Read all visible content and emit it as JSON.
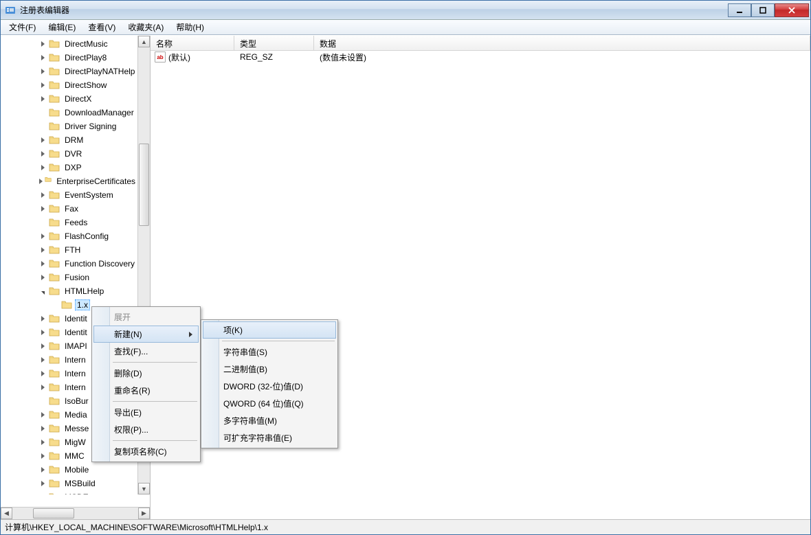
{
  "titlebar": {
    "title": "注册表编辑器"
  },
  "menu": {
    "file": "文件(F)",
    "edit": "编辑(E)",
    "view": "查看(V)",
    "favorites": "收藏夹(A)",
    "help": "帮助(H)"
  },
  "tree": {
    "items": [
      {
        "label": "DirectMusic",
        "expandable": true,
        "indent": 3
      },
      {
        "label": "DirectPlay8",
        "expandable": true,
        "indent": 3
      },
      {
        "label": "DirectPlayNATHelp",
        "expandable": true,
        "indent": 3
      },
      {
        "label": "DirectShow",
        "expandable": true,
        "indent": 3
      },
      {
        "label": "DirectX",
        "expandable": true,
        "indent": 3
      },
      {
        "label": "DownloadManager",
        "expandable": false,
        "indent": 3
      },
      {
        "label": "Driver Signing",
        "expandable": false,
        "indent": 3
      },
      {
        "label": "DRM",
        "expandable": true,
        "indent": 3
      },
      {
        "label": "DVR",
        "expandable": true,
        "indent": 3
      },
      {
        "label": "DXP",
        "expandable": true,
        "indent": 3
      },
      {
        "label": "EnterpriseCertificates",
        "expandable": true,
        "indent": 3
      },
      {
        "label": "EventSystem",
        "expandable": true,
        "indent": 3
      },
      {
        "label": "Fax",
        "expandable": true,
        "indent": 3
      },
      {
        "label": "Feeds",
        "expandable": false,
        "indent": 3
      },
      {
        "label": "FlashConfig",
        "expandable": true,
        "indent": 3
      },
      {
        "label": "FTH",
        "expandable": true,
        "indent": 3
      },
      {
        "label": "Function Discovery",
        "expandable": true,
        "indent": 3
      },
      {
        "label": "Fusion",
        "expandable": true,
        "indent": 3
      }
    ],
    "html_help_label": "HTMLHelp",
    "selected": "1.x",
    "items_after": [
      {
        "label": "Identit",
        "expandable": true,
        "indent": 3
      },
      {
        "label": "Identit",
        "expandable": true,
        "indent": 3
      },
      {
        "label": "IMAPI",
        "expandable": true,
        "indent": 3
      },
      {
        "label": "Intern",
        "expandable": true,
        "indent": 3
      },
      {
        "label": "Intern",
        "expandable": true,
        "indent": 3
      },
      {
        "label": "Intern",
        "expandable": true,
        "indent": 3
      },
      {
        "label": "IsoBur",
        "expandable": false,
        "indent": 3
      },
      {
        "label": "Media",
        "expandable": true,
        "indent": 3
      },
      {
        "label": "Messe",
        "expandable": true,
        "indent": 3
      },
      {
        "label": "MigW",
        "expandable": true,
        "indent": 3
      },
      {
        "label": "MMC",
        "expandable": true,
        "indent": 3
      },
      {
        "label": "Mobile",
        "expandable": true,
        "indent": 3
      },
      {
        "label": "MSBuild",
        "expandable": true,
        "indent": 3
      },
      {
        "label": "MSDE",
        "expandable": true,
        "indent": 3
      }
    ]
  },
  "list": {
    "headers": {
      "name": "名称",
      "type": "类型",
      "data": "数据"
    },
    "row": {
      "name": "(默认)",
      "type": "REG_SZ",
      "data": "(数值未设置)"
    }
  },
  "ctx1": {
    "expand": "展开",
    "new": "新建(N)",
    "find": "查找(F)...",
    "delete": "删除(D)",
    "rename": "重命名(R)",
    "export": "导出(E)",
    "permissions": "权限(P)...",
    "copykey": "复制项名称(C)"
  },
  "ctx2": {
    "key": "项(K)",
    "string": "字符串值(S)",
    "binary": "二进制值(B)",
    "dword": "DWORD (32-位)值(D)",
    "qword": "QWORD (64 位)值(Q)",
    "multi": "多字符串值(M)",
    "expand": "可扩充字符串值(E)"
  },
  "statusbar": {
    "path": "计算机\\HKEY_LOCAL_MACHINE\\SOFTWARE\\Microsoft\\HTMLHelp\\1.x"
  }
}
